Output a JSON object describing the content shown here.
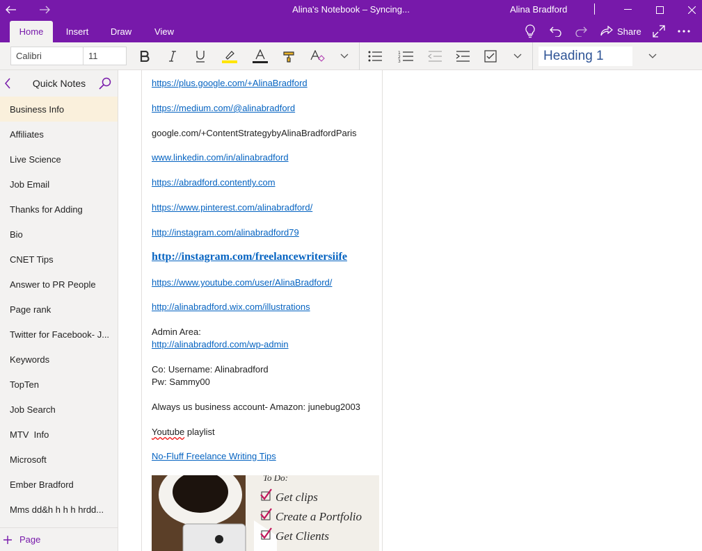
{
  "titlebar": {
    "title": "Alina's Notebook – Syncing...",
    "user": "Alina Bradford",
    "color": "#7719aa"
  },
  "ribbon": {
    "tabs": [
      "Home",
      "Insert",
      "Draw",
      "View"
    ],
    "active_tab": "Home",
    "share_label": "Share"
  },
  "toolbar": {
    "font_name": "Calibri",
    "font_size": "11",
    "style_value": "Heading 1"
  },
  "sidebar": {
    "section_title": "Quick Notes",
    "pages": [
      "Business Info",
      "Affiliates",
      "Live Science",
      "Job Email",
      "Thanks for Adding",
      "Bio",
      "CNET Tips",
      "Answer to PR People",
      "Page rank",
      "Twitter for Facebook- J...",
      "Keywords",
      "TopTen",
      "Job Search",
      "MTV  Info",
      "Microsoft",
      "Ember Bradford",
      "Mms dd&h h h h hrdd..."
    ],
    "active_page": "Business Info",
    "add_page_label": "Page"
  },
  "note": {
    "lines": [
      "https://plus.google.com/+AlinaBradford",
      "https://medium.com/@alinabradford",
      "google.com/+ContentStrategybyAlinaBradfordParis",
      "www.linkedin.com/in/alinabradford",
      "https://abradford.contently.com",
      "https://www.pinterest.com/alinabradford/",
      "http://instagram.com/alinabradford79",
      "http://instagram.com/freelancewritersiife",
      "https://www.youtube.com/user/AlinaBradford/",
      "http://alinabradford.wix.com/illustrations",
      "Admin Area:",
      "http://alinabradford.com/wp-admin",
      "Co: Username: Alinabradford",
      "Pw: Sammy00",
      "Always us business account- Amazon: junebug2003",
      "Youtube",
      "playlist",
      "No-Fluff Freelance Writing Tips"
    ],
    "video": {
      "todo_title": "To Do:",
      "items": [
        "Get clips",
        "Create a Portfolio",
        "Get Clients"
      ]
    }
  }
}
